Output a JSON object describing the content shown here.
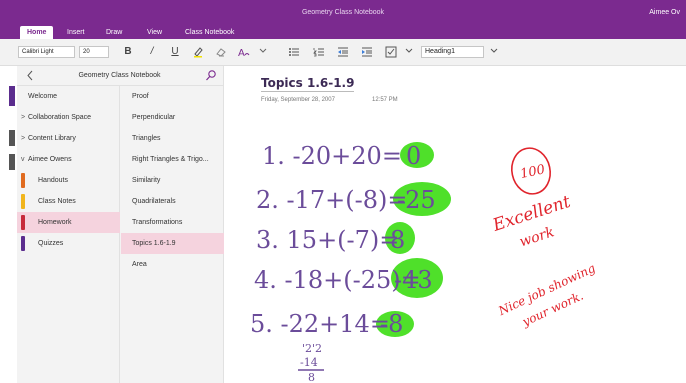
{
  "window": {
    "title": "Geometry Class Notebook",
    "user": "Aimee Ov"
  },
  "tabs": [
    {
      "label": "Home",
      "active": true
    },
    {
      "label": "Insert"
    },
    {
      "label": "Draw"
    },
    {
      "label": "View"
    },
    {
      "label": "Class Notebook"
    }
  ],
  "toolbar": {
    "font": "Calibri Light",
    "size": "20",
    "bold": "B",
    "italic": "/",
    "underline": "U",
    "style": "Heading1"
  },
  "nav": {
    "title": "Geometry Class Notebook",
    "sections": [
      {
        "label": "Welcome",
        "chevron": ""
      },
      {
        "label": "Collaboration Space",
        "chevron": ">"
      },
      {
        "label": "Content Library",
        "chevron": ">"
      },
      {
        "label": "Aimee Owens",
        "chevron": "v"
      },
      {
        "label": "Handouts",
        "color": "#e06b1f"
      },
      {
        "label": "Class Notes",
        "color": "#f1b51c"
      },
      {
        "label": "Homework",
        "color": "#c72a3b",
        "selected": true
      },
      {
        "label": "Quizzes",
        "color": "#5b2d8e"
      }
    ],
    "pages": [
      {
        "label": "Proof"
      },
      {
        "label": "Perpendicular"
      },
      {
        "label": "Triangles"
      },
      {
        "label": "Right Triangles & Trigo..."
      },
      {
        "label": "Similarity"
      },
      {
        "label": "Quadrilaterals"
      },
      {
        "label": "Transformations"
      },
      {
        "label": "Topics 1.6-1.9",
        "selected": true
      },
      {
        "label": "Area"
      }
    ]
  },
  "page": {
    "title": "Topics 1.6-1.9",
    "date": "Friday, September 28, 2007",
    "time": "12:57 PM"
  },
  "ink": {
    "lines": [
      {
        "problem": "1. -20+20=",
        "answer": "0"
      },
      {
        "problem": "2. -17+(-8)=",
        "answer": "-25"
      },
      {
        "problem": "3. 15+(-7)=",
        "answer": "8"
      },
      {
        "problem": "4. -18+(-25)=",
        "answer": "-43"
      },
      {
        "problem": "5. -22+14=",
        "answer": "-8"
      }
    ],
    "work": [
      "'2'2",
      "-14",
      "8"
    ],
    "teacher": {
      "score": "100",
      "comment1": "Excellent",
      "comment2": "work",
      "comment3": "Nice job showing",
      "comment4": "your work."
    },
    "colors": {
      "pen": "#6b4c9a",
      "highlight": "#4fe02a",
      "teacher": "#e0242c"
    }
  }
}
